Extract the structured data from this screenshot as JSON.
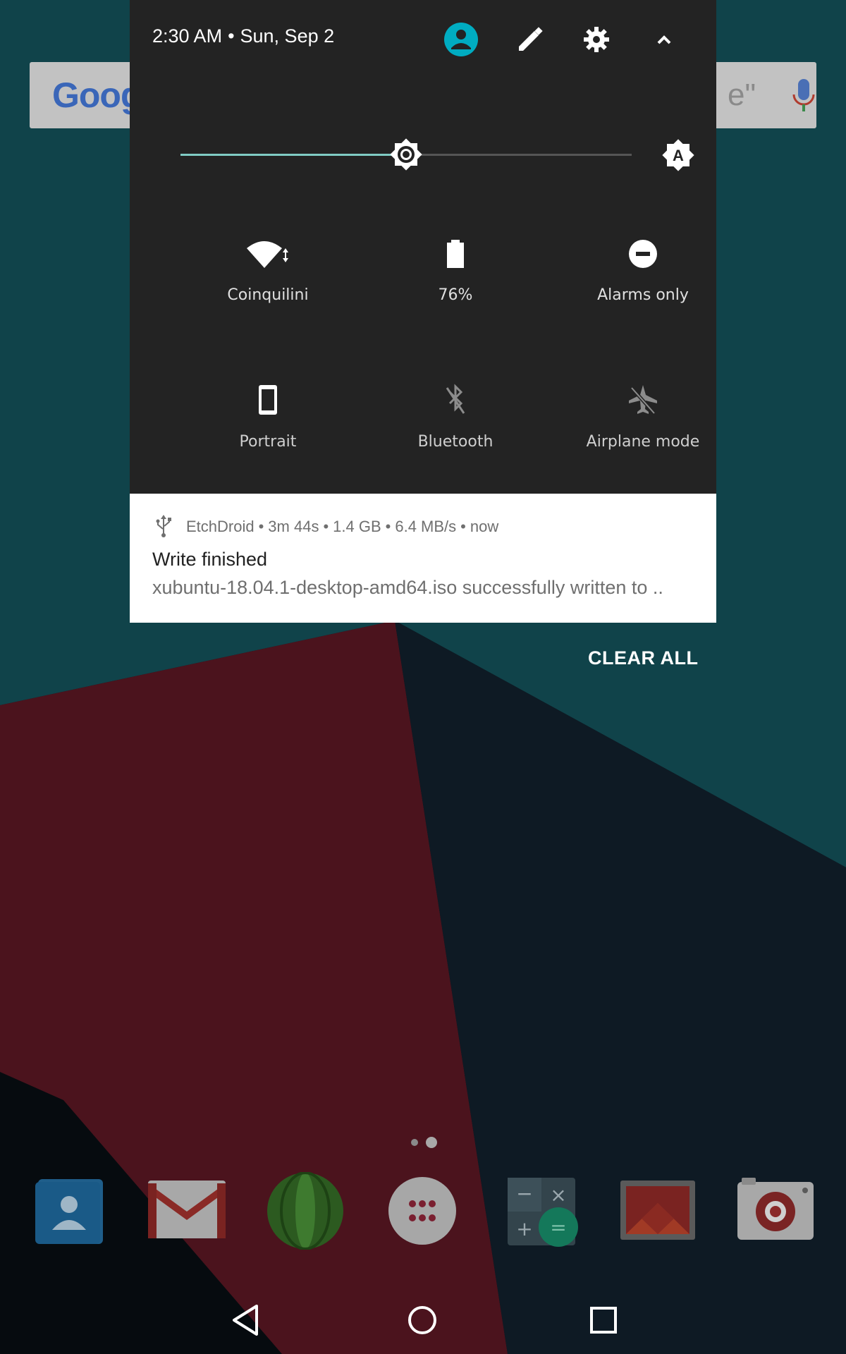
{
  "status": {
    "time": "2:30 AM",
    "separator": "•",
    "date": "Sun, Sep 2"
  },
  "header_icons": [
    "account-icon",
    "edit-icon",
    "settings-icon",
    "collapse-icon"
  ],
  "brightness": {
    "level": 0.5,
    "auto_label": "A"
  },
  "search": {
    "logo": "Googl",
    "hint": "e\""
  },
  "tiles": [
    {
      "label": "Coinquilini",
      "icon": "wifi-icon"
    },
    {
      "label": "76%",
      "icon": "battery-icon"
    },
    {
      "label": "Alarms only",
      "icon": "do-not-disturb-icon"
    },
    {
      "label": "Portrait",
      "icon": "portrait-icon"
    },
    {
      "label": "Bluetooth",
      "icon": "bluetooth-off-icon"
    },
    {
      "label": "Airplane mode",
      "icon": "airplane-off-icon"
    }
  ],
  "notification": {
    "app": "EtchDroid",
    "sep": "•",
    "elapsed": "3m 44s",
    "size": "1.4 GB",
    "speed": "6.4 MB/s",
    "when": "now",
    "title": "Write finished",
    "text": "xubuntu-18.04.1-desktop-amd64.iso successfully written to .."
  },
  "clear_all": "CLEAR ALL",
  "dock": [
    "contacts-icon",
    "gmail-icon",
    "app-icon",
    "app-drawer-icon",
    "calculator-icon",
    "gallery-icon",
    "camera-icon"
  ],
  "colors": {
    "shade_bg": "#232323",
    "accent": "#80cbc4",
    "avatar": "#00acc1"
  }
}
